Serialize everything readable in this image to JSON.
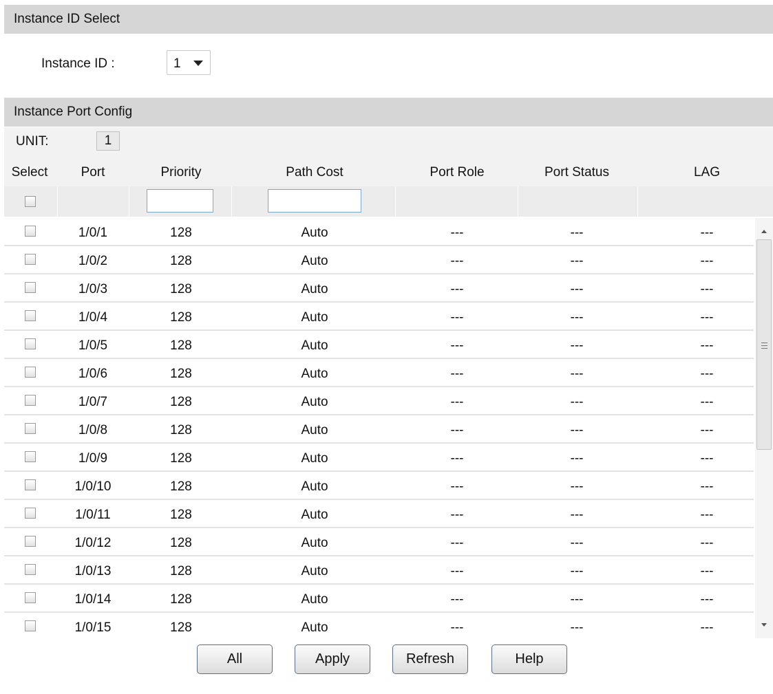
{
  "instance_select": {
    "header": "Instance ID Select",
    "label": "Instance ID :",
    "selected": "1"
  },
  "port_config": {
    "header": "Instance Port Config",
    "unit_label": "UNIT:",
    "unit_value": "1",
    "columns": [
      "Select",
      "Port",
      "Priority",
      "Path Cost",
      "Port Role",
      "Port Status",
      "LAG"
    ],
    "rows": [
      {
        "port": "1/0/1",
        "priority": "128",
        "path_cost": "Auto",
        "role": "---",
        "status": "---",
        "lag": "---"
      },
      {
        "port": "1/0/2",
        "priority": "128",
        "path_cost": "Auto",
        "role": "---",
        "status": "---",
        "lag": "---"
      },
      {
        "port": "1/0/3",
        "priority": "128",
        "path_cost": "Auto",
        "role": "---",
        "status": "---",
        "lag": "---"
      },
      {
        "port": "1/0/4",
        "priority": "128",
        "path_cost": "Auto",
        "role": "---",
        "status": "---",
        "lag": "---"
      },
      {
        "port": "1/0/5",
        "priority": "128",
        "path_cost": "Auto",
        "role": "---",
        "status": "---",
        "lag": "---"
      },
      {
        "port": "1/0/6",
        "priority": "128",
        "path_cost": "Auto",
        "role": "---",
        "status": "---",
        "lag": "---"
      },
      {
        "port": "1/0/7",
        "priority": "128",
        "path_cost": "Auto",
        "role": "---",
        "status": "---",
        "lag": "---"
      },
      {
        "port": "1/0/8",
        "priority": "128",
        "path_cost": "Auto",
        "role": "---",
        "status": "---",
        "lag": "---"
      },
      {
        "port": "1/0/9",
        "priority": "128",
        "path_cost": "Auto",
        "role": "---",
        "status": "---",
        "lag": "---"
      },
      {
        "port": "1/0/10",
        "priority": "128",
        "path_cost": "Auto",
        "role": "---",
        "status": "---",
        "lag": "---"
      },
      {
        "port": "1/0/11",
        "priority": "128",
        "path_cost": "Auto",
        "role": "---",
        "status": "---",
        "lag": "---"
      },
      {
        "port": "1/0/12",
        "priority": "128",
        "path_cost": "Auto",
        "role": "---",
        "status": "---",
        "lag": "---"
      },
      {
        "port": "1/0/13",
        "priority": "128",
        "path_cost": "Auto",
        "role": "---",
        "status": "---",
        "lag": "---"
      },
      {
        "port": "1/0/14",
        "priority": "128",
        "path_cost": "Auto",
        "role": "---",
        "status": "---",
        "lag": "---"
      },
      {
        "port": "1/0/15",
        "priority": "128",
        "path_cost": "Auto",
        "role": "---",
        "status": "---",
        "lag": "---"
      }
    ]
  },
  "buttons": {
    "all": "All",
    "apply": "Apply",
    "refresh": "Refresh",
    "help": "Help"
  }
}
